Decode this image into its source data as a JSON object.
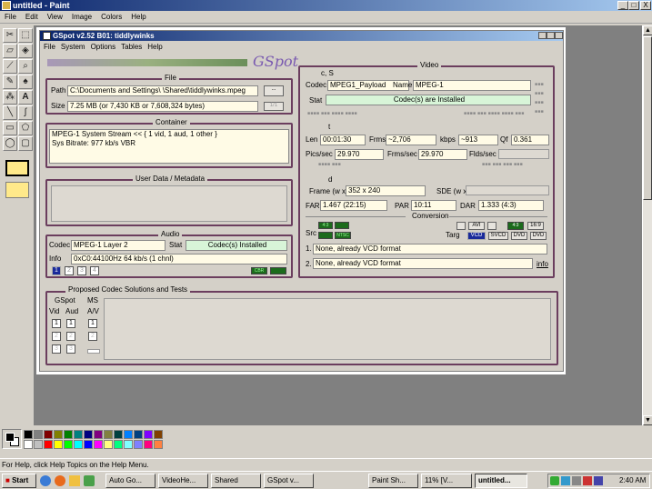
{
  "window": {
    "title": "untitled - Paint",
    "min": "_",
    "max": "□",
    "close": "X"
  },
  "menu": [
    "File",
    "Edit",
    "View",
    "Image",
    "Colors",
    "Help"
  ],
  "status_text": "For Help, click Help Topics on the Help Menu.",
  "gspot": {
    "title": "GSpot v2.52 B01: tiddlywinks",
    "menu": [
      "File",
      "System",
      "Options",
      "Tables",
      "Help"
    ],
    "logo": "GSpot",
    "file": {
      "title": "File",
      "path_label": "Path",
      "path": "C:\\Documents and Settings\\        \\Shared\\tiddlywinks.mpeg",
      "browse": "...",
      "size_label": "Size",
      "size": "7.25 MB (or 7,430 KB or 7,608,324 bytes)",
      "page": "1/1"
    },
    "container": {
      "title": "Container",
      "line1": "MPEG-1 System Stream << { 1 vid, 1 aud, 1 other }",
      "line2": "Sys Bitrate: 977 kb/s VBR"
    },
    "userdata": {
      "title": "User Data / Metadata"
    },
    "audio": {
      "title": "Audio",
      "codec_label": "Codec",
      "codec": "MPEG-1 Layer 2",
      "stat_label": "Stat",
      "stat": "Codec(s) Installed",
      "info_label": "Info",
      "info": "0xC0:44100Hz  64 kb/s (1 chnl)",
      "btn1": "1",
      "btn2": "2",
      "btn3": "3",
      "btn4": "4",
      "cbr": "CBR"
    },
    "video": {
      "title": "Video",
      "cs": "c, S",
      "codec_label": "Codec",
      "codec": "MPEG1_Payload",
      "name_label": "Name",
      "name": "MPEG-1",
      "stat_label": "Stat",
      "stat": "Codec(s) are Installed",
      "t_label": "t",
      "len_label": "Len",
      "len": "00:01:30",
      "frms_label": "Frms",
      "frms": "~2,706",
      "kbps_label": "kbps",
      "kbps": "~913",
      "qf_label": "Qf",
      "qf": "0.361",
      "pics_label": "Pics/sec",
      "pics": "29.970",
      "frmssec_label": "Frms/sec",
      "frmssec": "29.970",
      "flds_label": "Flds/sec",
      "d_label": "d",
      "frame_label": "Frame (w x",
      "frame": "352 x 240",
      "sde_label": "SDE (w x",
      "far_label": "FAR",
      "far": "1.467 (22:15)",
      "par_label": "PAR",
      "par": "10:11",
      "dar_label": "DAR",
      "dar": "1.333 (4:3)",
      "conversion": "Conversion",
      "src_label": "Src",
      "targ_label": "Targ",
      "avi": "AVI",
      "r43": "4:3",
      "r169": "16:9",
      "vcd": "VCD",
      "svcd": "SVCD",
      "dvd": "DVD",
      "dvd2": "DVD",
      "ntsc": "NTSC",
      "conv1_num": "1.",
      "conv1": "None, already VCD format",
      "conv2_num": "2.",
      "conv2": "None, already VCD format",
      "info": "info"
    },
    "proposed": {
      "title": "Proposed Codec Solutions and Tests",
      "gspot": "GSpot",
      "ms": "MS",
      "vid": "Vid",
      "aud": "Aud",
      "av": "A/V",
      "n1": "1",
      "n2": "2",
      "n3": "3"
    }
  },
  "taskbar": {
    "start": "Start",
    "items": [
      "Auto Go...",
      "VideoHe...",
      "Shared",
      "GSpot v...",
      "Paint Sh...",
      "11% [V...",
      "untitled..."
    ],
    "clock": "2:40 AM"
  },
  "colors": {
    "accent": "#0a246a",
    "frame": "#6b3e5e"
  }
}
